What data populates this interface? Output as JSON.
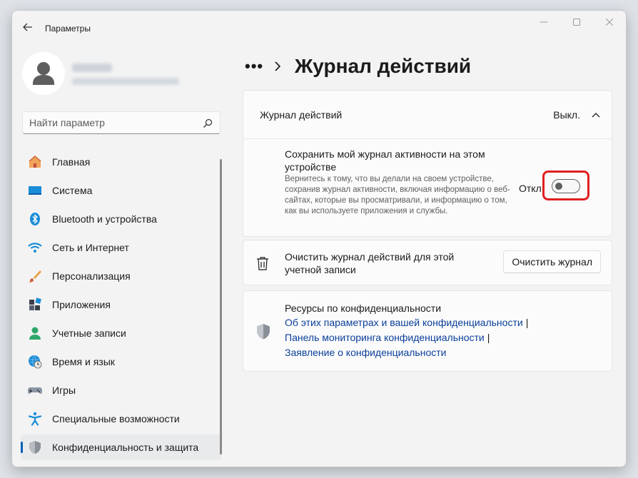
{
  "window": {
    "title": "Параметры"
  },
  "profile": {
    "name": "",
    "email": ""
  },
  "search": {
    "placeholder": "Найти параметр"
  },
  "sidebar": {
    "items": [
      {
        "label": "Главная",
        "icon": "home-icon"
      },
      {
        "label": "Система",
        "icon": "monitor-icon"
      },
      {
        "label": "Bluetooth и устройства",
        "icon": "bluetooth-icon"
      },
      {
        "label": "Сеть и Интернет",
        "icon": "wifi-icon"
      },
      {
        "label": "Персонализация",
        "icon": "brush-icon"
      },
      {
        "label": "Приложения",
        "icon": "apps-icon"
      },
      {
        "label": "Учетные записи",
        "icon": "user-icon"
      },
      {
        "label": "Время и язык",
        "icon": "globe-clock-icon"
      },
      {
        "label": "Игры",
        "icon": "gamepad-icon"
      },
      {
        "label": "Специальные возможности",
        "icon": "accessibility-icon"
      },
      {
        "label": "Конфиденциальность и защита",
        "icon": "shield-icon",
        "active": true
      }
    ]
  },
  "breadcrumb": {
    "more": "•••",
    "title": "Журнал действий"
  },
  "activity_card": {
    "title": "Журнал действий",
    "status": "Выкл.",
    "setting": {
      "title": "Сохранить мой журнал активности на этом устройстве",
      "description": "Вернитесь к тому, что вы делали на своем устройстве, сохранив журнал активности, включая информацию о веб-сайтах, которые вы просматривали, и информацию о том, как вы используете приложения и службы.",
      "toggle_label": "Откл.",
      "toggle_on": false
    }
  },
  "clear_card": {
    "text": "Очистить журнал действий для этой учетной записи",
    "button": "Очистить журнал"
  },
  "privacy_card": {
    "title": "Ресурсы по конфиденциальности",
    "links": [
      "Об этих параметрах и вашей конфиденциальности",
      "Панель мониторинга конфиденциальности",
      "Заявление о конфиденциальности"
    ],
    "separator": "|"
  },
  "colors": {
    "accent": "#005fb8",
    "highlight": "#e02020",
    "link": "#0a3f9a"
  }
}
